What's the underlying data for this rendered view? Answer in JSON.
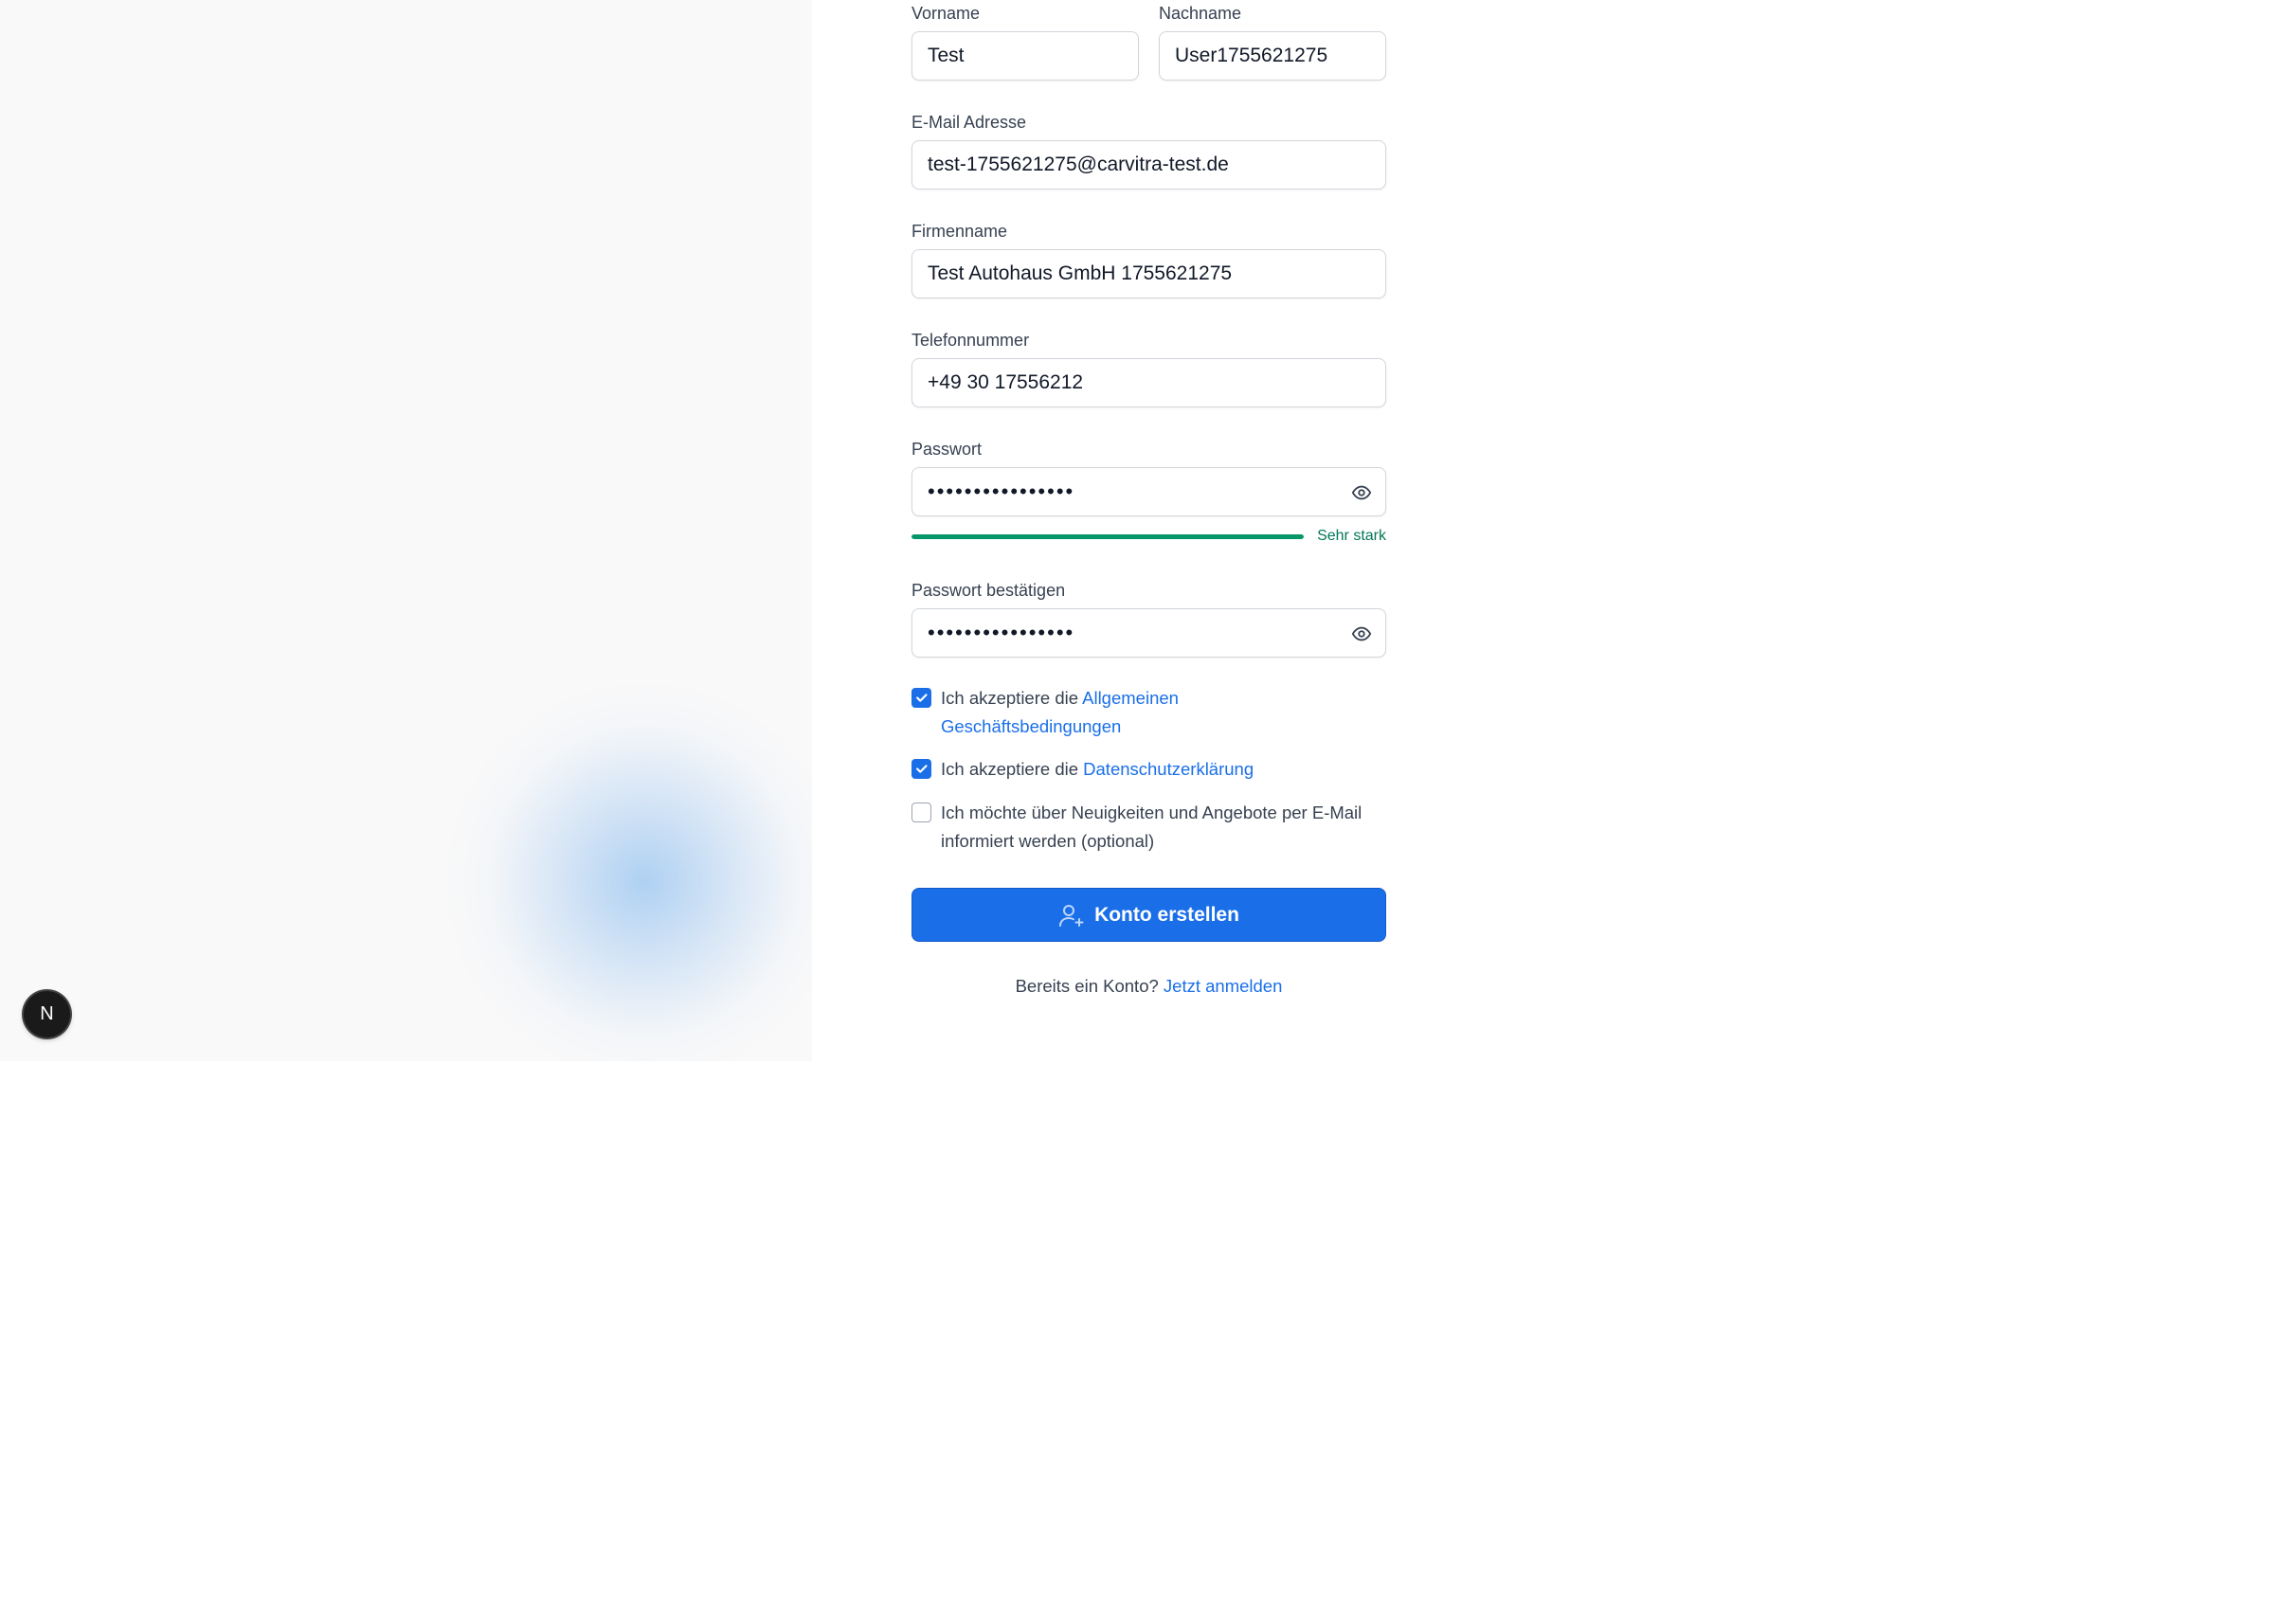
{
  "form": {
    "firstname": {
      "label": "Vorname",
      "value": "Test"
    },
    "lastname": {
      "label": "Nachname",
      "value": "User1755621275"
    },
    "email": {
      "label": "E-Mail Adresse",
      "value": "test-1755621275@carvitra-test.de"
    },
    "company": {
      "label": "Firmenname",
      "value": "Test Autohaus GmbH 1755621275"
    },
    "phone": {
      "label": "Telefonnummer",
      "value": "+49 30 17556212"
    },
    "password": {
      "label": "Passwort",
      "value": "••••••••••••••••",
      "strength_label": "Sehr stark",
      "strength_fraction": 1.0
    },
    "password_confirm": {
      "label": "Passwort bestätigen",
      "value": "••••••••••••••••"
    },
    "terms": {
      "prefix": "Ich akzeptiere die ",
      "link_line1": "Allgemeinen",
      "link_line2": "Geschäftsbedingungen",
      "checked": true
    },
    "privacy": {
      "prefix": "Ich akzeptiere die ",
      "link": "Datenschutzerklärung",
      "checked": true
    },
    "newsletter": {
      "line1": "Ich möchte über Neuigkeiten und Angebote per E-Mail",
      "line2": "informiert werden (optional)",
      "checked": false
    },
    "submit_label": "Konto erstellen",
    "login_prompt": "Bereits ein Konto?",
    "login_link": "Jetzt anmelden"
  },
  "badge": {
    "letter": "N"
  },
  "colors": {
    "accent": "#1a6fe8",
    "strength": "#059669",
    "left_panel": "#f9f9f9"
  },
  "icons": {
    "eye": "eye-icon",
    "add_user": "user-plus-icon",
    "check": "check-icon"
  }
}
